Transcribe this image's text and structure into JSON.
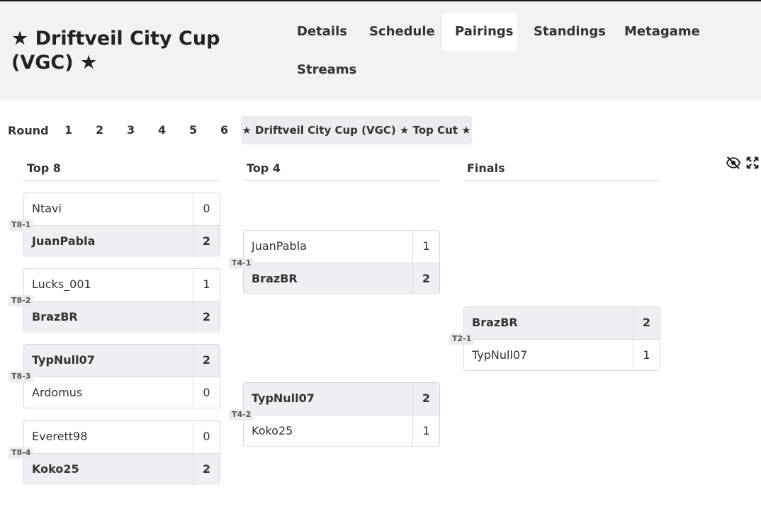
{
  "header": {
    "title": "★ Driftveil City Cup (VGC) ★",
    "tabs": [
      "Details",
      "Schedule",
      "Pairings",
      "Standings",
      "Metagame",
      "Streams"
    ],
    "active_tab": "Pairings"
  },
  "rounds": {
    "label": "Round",
    "numbers": [
      "1",
      "2",
      "3",
      "4",
      "5",
      "6"
    ],
    "top_cut": "★ Driftveil City Cup (VGC) ★ Top Cut ★"
  },
  "bracket": {
    "columns": [
      "Top 8",
      "Top 4",
      "Finals"
    ],
    "matches": [
      {
        "id": "T8-1",
        "p1": "Ntavi",
        "s1": "0",
        "p2": "JuanPabla",
        "s2": "2",
        "winner": 2
      },
      {
        "id": "T8-2",
        "p1": "Lucks_001",
        "s1": "1",
        "p2": "BrazBR",
        "s2": "2",
        "winner": 2
      },
      {
        "id": "T8-3",
        "p1": "TypNull07",
        "s1": "2",
        "p2": "Ardomus",
        "s2": "0",
        "winner": 1
      },
      {
        "id": "T8-4",
        "p1": "Everett98",
        "s1": "0",
        "p2": "Koko25",
        "s2": "2",
        "winner": 2
      },
      {
        "id": "T4-1",
        "p1": "JuanPabla",
        "s1": "1",
        "p2": "BrazBR",
        "s2": "2",
        "winner": 2
      },
      {
        "id": "T4-2",
        "p1": "TypNull07",
        "s1": "2",
        "p2": "Koko25",
        "s2": "1",
        "winner": 1
      },
      {
        "id": "T2-1",
        "p1": "BrazBR",
        "s1": "2",
        "p2": "TypNull07",
        "s2": "1",
        "winner": 1
      }
    ]
  },
  "icons": {
    "hide": "eye-slash-icon",
    "fullscreen": "expand-icon"
  }
}
